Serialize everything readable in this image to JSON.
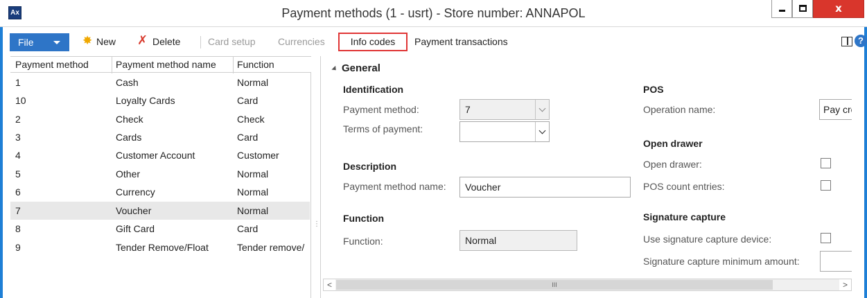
{
  "window": {
    "title": "Payment methods (1 - usrt) - Store number: ANNAPOL",
    "app_icon_text": "Ax",
    "close_glyph": "x"
  },
  "toolbar": {
    "file_label": "File",
    "new_label": "New",
    "delete_label": "Delete",
    "card_setup_label": "Card setup",
    "currencies_label": "Currencies",
    "info_codes_label": "Info codes",
    "payment_transactions_label": "Payment transactions",
    "help_glyph": "?"
  },
  "grid": {
    "columns": [
      "Payment method",
      "Payment method name",
      "Function"
    ],
    "rows": [
      {
        "method": "1",
        "name": "Cash",
        "function": "Normal"
      },
      {
        "method": "10",
        "name": "Loyalty Cards",
        "function": "Card"
      },
      {
        "method": "2",
        "name": "Check",
        "function": "Check"
      },
      {
        "method": "3",
        "name": "Cards",
        "function": "Card"
      },
      {
        "method": "4",
        "name": "Customer Account",
        "function": "Customer"
      },
      {
        "method": "5",
        "name": "Other",
        "function": "Normal"
      },
      {
        "method": "6",
        "name": "Currency",
        "function": "Normal"
      },
      {
        "method": "7",
        "name": "Voucher",
        "function": "Normal"
      },
      {
        "method": "8",
        "name": "Gift Card",
        "function": "Card"
      },
      {
        "method": "9",
        "name": "Tender Remove/Float",
        "function": "Tender remove/"
      }
    ],
    "selected_method": "7"
  },
  "detail": {
    "section_title": "General",
    "identification": {
      "heading": "Identification",
      "payment_method_label": "Payment method:",
      "payment_method_value": "7",
      "terms_label": "Terms of payment:",
      "terms_value": ""
    },
    "description": {
      "heading": "Description",
      "name_label": "Payment method name:",
      "name_value": "Voucher"
    },
    "function": {
      "heading": "Function",
      "label": "Function:",
      "value": "Normal"
    },
    "pos": {
      "heading": "POS",
      "operation_label": "Operation name:",
      "operation_value": "Pay cre"
    },
    "open_drawer": {
      "heading": "Open drawer",
      "open_drawer_label": "Open drawer:",
      "open_drawer_checked": false,
      "count_entries_label": "POS count entries:",
      "count_entries_checked": false
    },
    "signature": {
      "heading": "Signature capture",
      "use_device_label": "Use signature capture device:",
      "use_device_checked": false,
      "min_amount_label": "Signature capture minimum amount:",
      "min_amount_value": ""
    }
  },
  "scrollbar": {
    "left_glyph": "<",
    "thumb_glyph": "III",
    "right_glyph": ">"
  },
  "colors": {
    "accent": "#2e75c7",
    "highlight_border": "#e03535",
    "selected_row": "#e8e8e8",
    "close_button": "#d9362c"
  }
}
